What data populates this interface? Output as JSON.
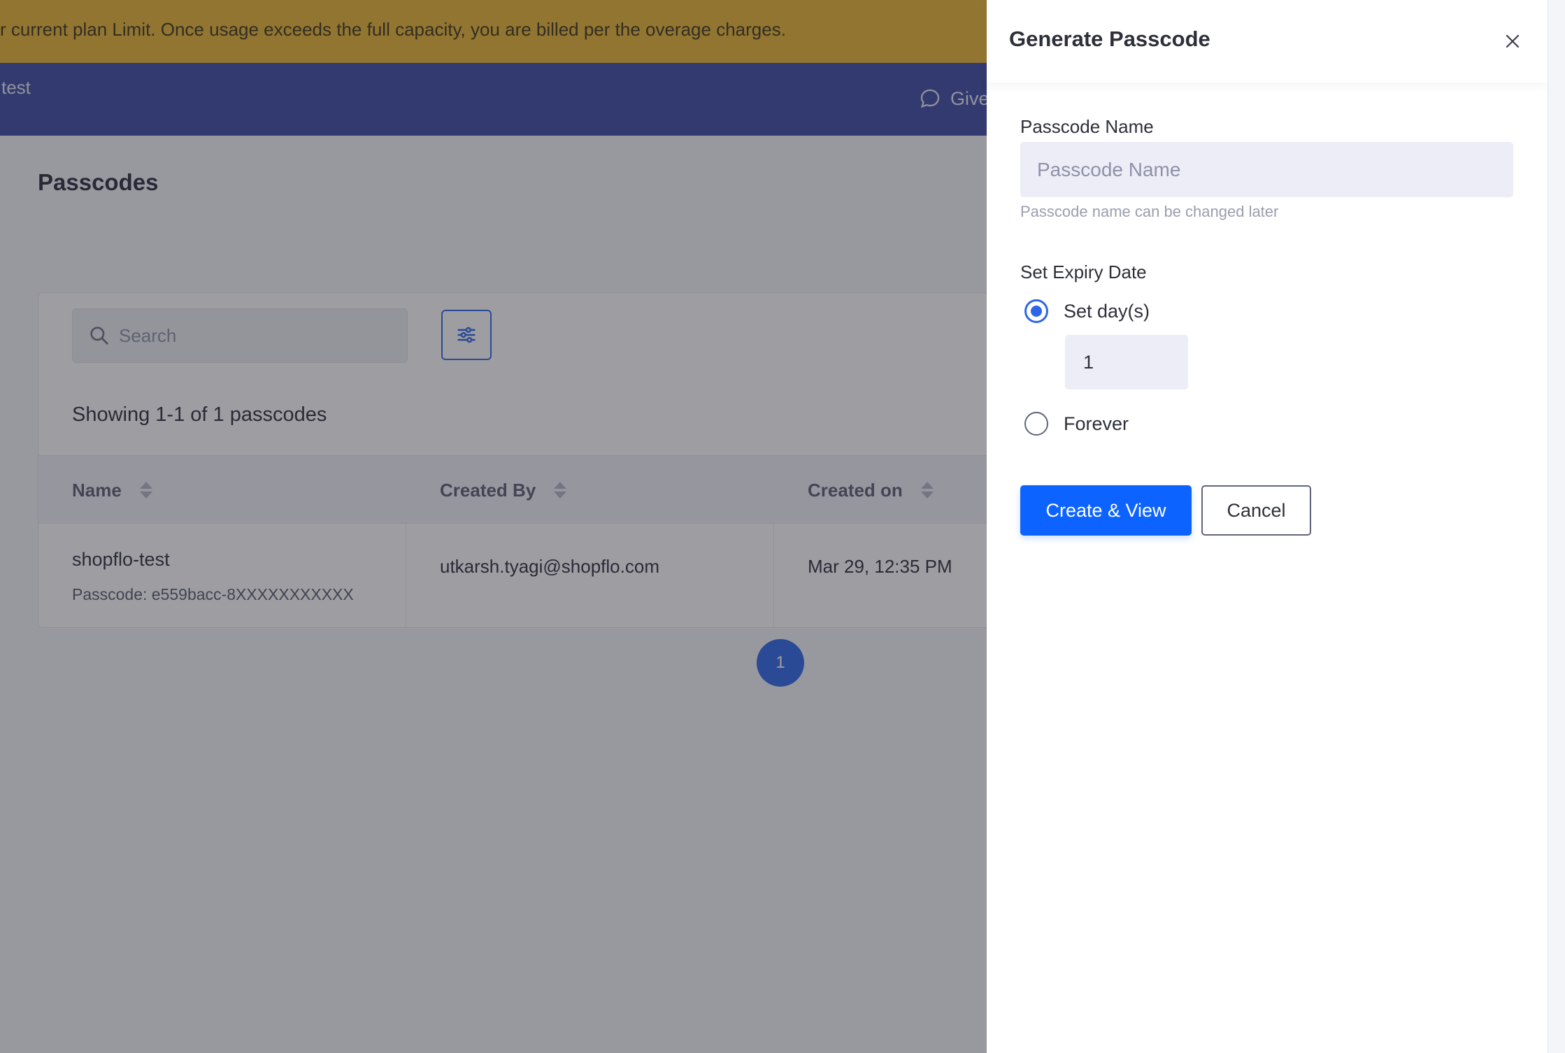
{
  "banner": {
    "text": "r current plan Limit. Once usage exceeds the full capacity, you are billed per the overage charges.",
    "color": "#eab532"
  },
  "topbar": {
    "store_name": "test",
    "feedback_label": "Give",
    "color": "#3c4aa3"
  },
  "page": {
    "title": "Passcodes"
  },
  "toolbar": {
    "search_placeholder": "Search",
    "filter_icon": "sliders-icon"
  },
  "table": {
    "summary": "Showing 1-1 of 1 passcodes",
    "columns": [
      "Name",
      "Created By",
      "Created on"
    ],
    "rows": [
      {
        "name": "shopflo-test",
        "passcode": "Passcode: e559bacc-8XXXXXXXXXXX",
        "created_by": "utkarsh.tyagi@shopflo.com",
        "created_on": "Mar 29, 12:35 PM"
      }
    ]
  },
  "pagination": {
    "current_page": "1",
    "accent": "#2f66e8"
  },
  "drawer": {
    "title": "Generate Passcode",
    "close_icon": "close-icon",
    "passcode_name_label": "Passcode Name",
    "passcode_name_placeholder": "Passcode Name",
    "passcode_name_value": "",
    "passcode_name_helper": "Passcode name can be changed later",
    "expiry_label": "Set Expiry Date",
    "options": [
      {
        "label": "Set day(s)",
        "selected": true
      },
      {
        "label": "Forever",
        "selected": false
      }
    ],
    "days_value": "1",
    "primary_button": "Create & View",
    "secondary_button": "Cancel",
    "primary_color": "#0c63ff"
  }
}
